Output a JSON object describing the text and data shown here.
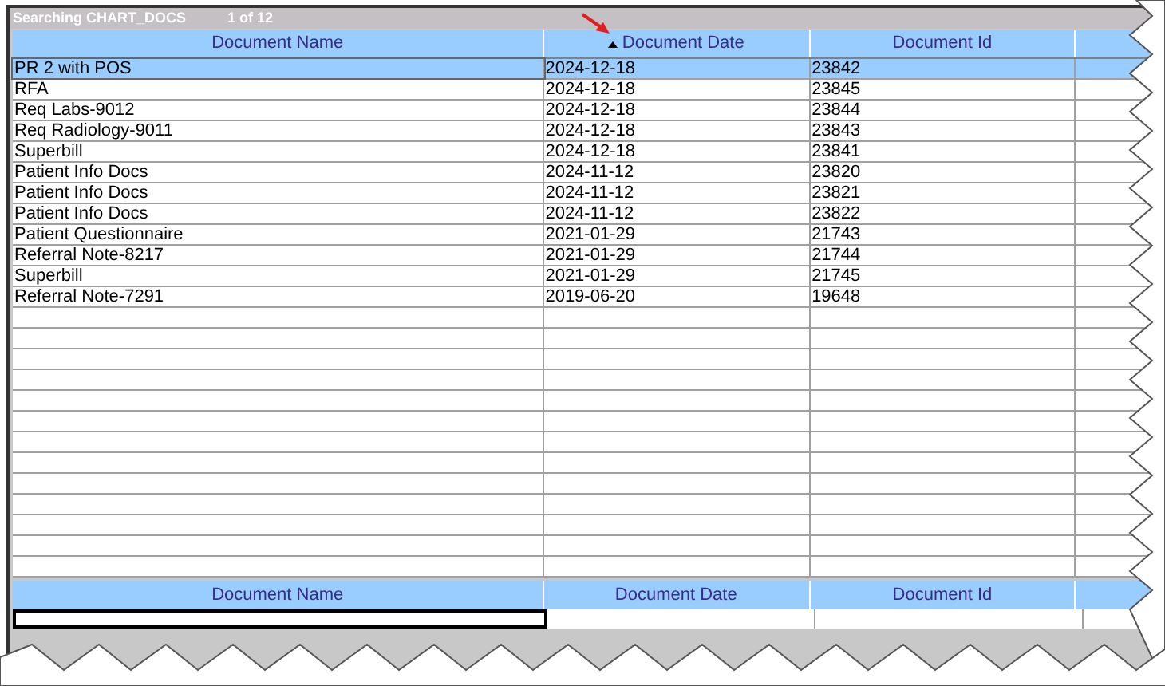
{
  "title_bar": {
    "title": "Searching CHART_DOCS",
    "count": "1 of 12"
  },
  "columns": [
    {
      "label": "Document Name",
      "sorted": false
    },
    {
      "label": "Document Date",
      "sorted": true
    },
    {
      "label": "Document Id",
      "sorted": false
    }
  ],
  "rows": [
    {
      "cells": [
        "PR 2 with POS",
        "2024-12-18",
        "23842"
      ],
      "selected": true
    },
    {
      "cells": [
        "RFA",
        "2024-12-18",
        "23845"
      ],
      "selected": false
    },
    {
      "cells": [
        "Req Labs-9012",
        "2024-12-18",
        "23844"
      ],
      "selected": false
    },
    {
      "cells": [
        "Req Radiology-9011",
        "2024-12-18",
        "23843"
      ],
      "selected": false
    },
    {
      "cells": [
        "Superbill",
        "2024-12-18",
        "23841"
      ],
      "selected": false
    },
    {
      "cells": [
        "Patient Info Docs",
        "2024-11-12",
        "23820"
      ],
      "selected": false
    },
    {
      "cells": [
        "Patient Info Docs",
        "2024-11-12",
        "23821"
      ],
      "selected": false
    },
    {
      "cells": [
        "Patient Info Docs",
        "2024-11-12",
        "23822"
      ],
      "selected": false
    },
    {
      "cells": [
        "Patient Questionnaire",
        "2021-01-29",
        "21743"
      ],
      "selected": false
    },
    {
      "cells": [
        "Referral Note-8217",
        "2021-01-29",
        "21744"
      ],
      "selected": false
    },
    {
      "cells": [
        "Superbill",
        "2021-01-29",
        "21745"
      ],
      "selected": false
    },
    {
      "cells": [
        "Referral Note-7291",
        "2019-06-20",
        "19648"
      ],
      "selected": false
    }
  ],
  "filter_columns": [
    "Document Name",
    "Document Date",
    "Document Id"
  ]
}
